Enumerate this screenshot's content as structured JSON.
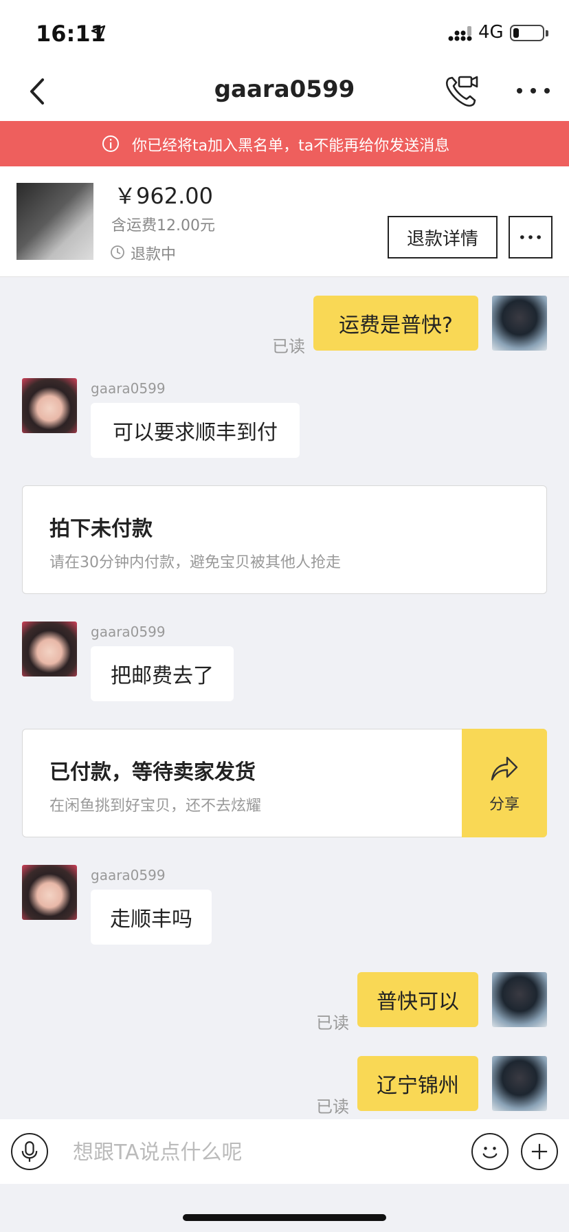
{
  "status_bar": {
    "time": "16:11",
    "network": "4G",
    "battery_level": 0.2
  },
  "nav": {
    "title": "gaara0599",
    "back_icon": "chevron-left-icon",
    "call_icon": "video-call-icon",
    "more_icon": "more-dots-icon"
  },
  "banner": {
    "text": "你已经将ta加入黑名单，ta不能再给你发送消息",
    "color": "#ee5f5d"
  },
  "product": {
    "price": "￥962.00",
    "shipping": "含运费12.00元",
    "status": "退款中",
    "refund_button": "退款详情"
  },
  "messages": [
    {
      "type": "text",
      "side": "me",
      "text": "运费是普快?",
      "read": "已读"
    },
    {
      "type": "text",
      "side": "her",
      "sender": "gaara0599",
      "text": "可以要求顺丰到付"
    },
    {
      "type": "card",
      "title": "拍下未付款",
      "subtitle": "请在30分钟内付款，避免宝贝被其他人抢走"
    },
    {
      "type": "text",
      "side": "her",
      "sender": "gaara0599",
      "text": "把邮费去了"
    },
    {
      "type": "card",
      "title": "已付款，等待卖家发货",
      "subtitle": "在闲鱼挑到好宝贝，还不去炫耀",
      "action": "分享"
    },
    {
      "type": "text",
      "side": "her",
      "sender": "gaara0599",
      "text": "走顺丰吗"
    },
    {
      "type": "text",
      "side": "me",
      "text": "普快可以",
      "read": "已读"
    },
    {
      "type": "text",
      "side": "me",
      "text": "辽宁锦州",
      "read": "已读"
    }
  ],
  "input": {
    "placeholder": "想跟TA说点什么呢",
    "value": ""
  },
  "colors": {
    "accent": "#f9d855",
    "background": "#f0f1f5"
  }
}
